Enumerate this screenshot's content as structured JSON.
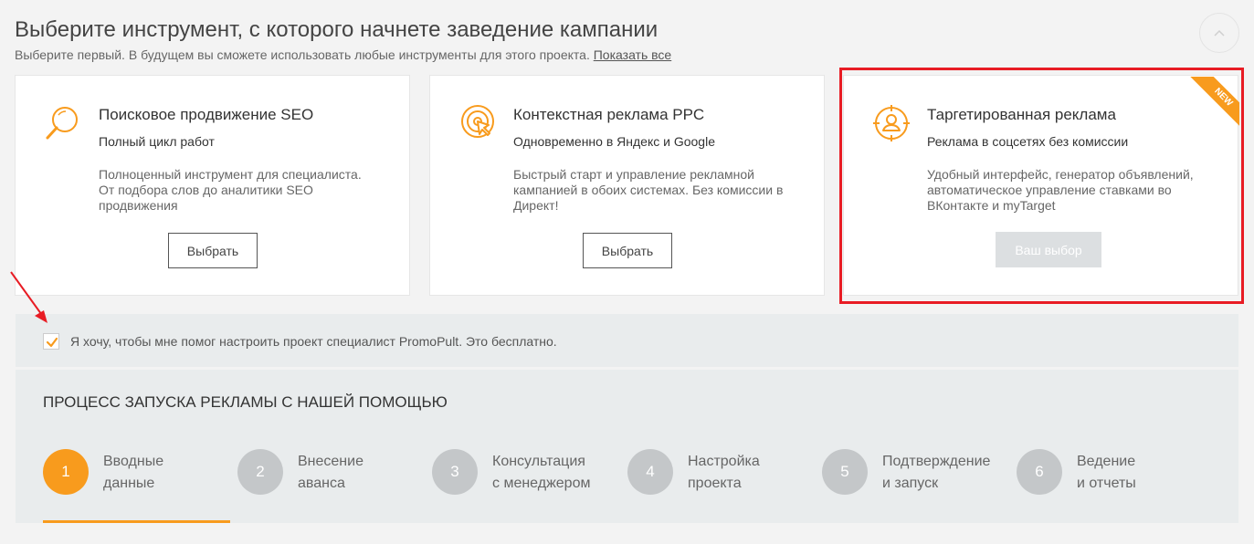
{
  "header": {
    "title": "Выберите инструмент, с которого начнете заведение кампании",
    "subtitle": "Выберите первый. В будущем вы сможете использовать любые инструменты для этого проекта.",
    "show_all": "Показать все"
  },
  "cards": [
    {
      "title": "Поисковое продвижение SEO",
      "subtitle": "Полный цикл работ",
      "description": "Полноценный инструмент для специалиста. От подбора слов до аналитики SEO продвижения",
      "button": "Выбрать",
      "icon": "magnifier-icon"
    },
    {
      "title": "Контекстная реклама PPC",
      "subtitle": "Одновременно в Яндекс и Google",
      "description": "Быстрый старт и управление рекламной кампанией в обоих системах. Без комиссии в Директ!",
      "button": "Выбрать",
      "icon": "target-cursor-icon"
    },
    {
      "title": "Таргетированная реклама",
      "subtitle": "Реклама в соцсетях без комиссии",
      "description": "Удобный интерфейс, генератор объявлений, автоматическое управление ставками во ВКонтакте и myTarget",
      "button": "Ваш выбор",
      "badge": "NEW",
      "icon": "person-crosshair-icon"
    }
  ],
  "consent": {
    "label": "Я хочу, чтобы мне помог настроить проект специалист PromoPult. Это бесплатно.",
    "checked": true
  },
  "process": {
    "title": "ПРОЦЕСС ЗАПУСКА РЕКЛАМЫ С НАШЕЙ ПОМОЩЬЮ",
    "steps": [
      {
        "num": "1",
        "line1": "Вводные",
        "line2": "данные"
      },
      {
        "num": "2",
        "line1": "Внесение",
        "line2": "аванса"
      },
      {
        "num": "3",
        "line1": "Консультация",
        "line2": "с менеджером"
      },
      {
        "num": "4",
        "line1": "Настройка",
        "line2": "проекта"
      },
      {
        "num": "5",
        "line1": "Подтверждение",
        "line2": "и запуск"
      },
      {
        "num": "6",
        "line1": "Ведение",
        "line2": "и отчеты"
      }
    ],
    "active_step": 1
  },
  "colors": {
    "accent": "#f89b1d",
    "highlight_frame": "#e81c24",
    "panel_bg": "#e9eced",
    "inactive_step": "#c4c7c9"
  }
}
